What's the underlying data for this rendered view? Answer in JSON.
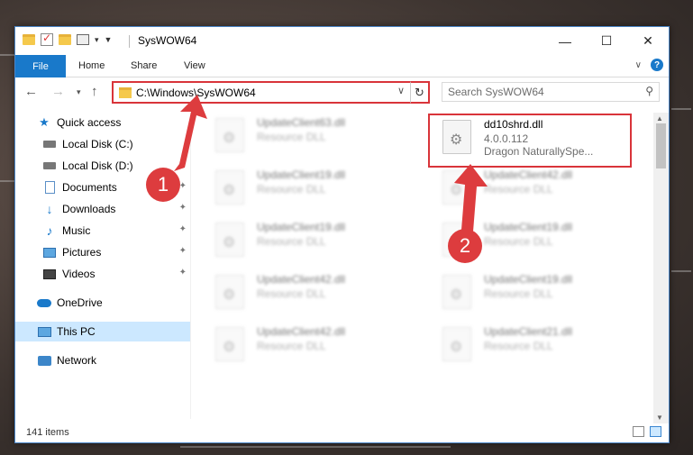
{
  "window": {
    "title": "SysWOW64",
    "controls": {
      "minimize": "—",
      "maximize": "☐",
      "close": "✕"
    }
  },
  "ribbon": {
    "tabs": [
      "File",
      "Home",
      "Share",
      "View"
    ],
    "help": "?"
  },
  "address_bar": {
    "path": "C:\\Windows\\SysWOW64",
    "search_placeholder": "Search SysWOW64"
  },
  "sidebar": {
    "items": [
      {
        "label": "Quick access",
        "icon": "star-icon",
        "pinned": false
      },
      {
        "label": "Local Disk (C:)",
        "icon": "drive-icon",
        "pinned": false
      },
      {
        "label": "Local Disk (D:)",
        "icon": "drive-icon",
        "pinned": true
      },
      {
        "label": "Documents",
        "icon": "document-icon",
        "pinned": true
      },
      {
        "label": "Downloads",
        "icon": "download-icon",
        "pinned": true
      },
      {
        "label": "Music",
        "icon": "music-icon",
        "pinned": true
      },
      {
        "label": "Pictures",
        "icon": "picture-icon",
        "pinned": true
      },
      {
        "label": "Videos",
        "icon": "video-icon",
        "pinned": true
      },
      {
        "label": "OneDrive",
        "icon": "cloud-icon",
        "pinned": false
      },
      {
        "label": "This PC",
        "icon": "pc-icon",
        "pinned": false,
        "selected": true
      },
      {
        "label": "Network",
        "icon": "network-icon",
        "pinned": false
      }
    ]
  },
  "files": {
    "highlighted": {
      "name": "dd10shrd.dll",
      "version": "4.0.0.112",
      "description": "Dragon NaturallySpe..."
    },
    "left_column": [
      {
        "name": "UpdateClient63.dll",
        "type": "Resource DLL"
      },
      {
        "name": "UpdateClient19.dll",
        "type": "Resource DLL"
      },
      {
        "name": "UpdateClient19.dll",
        "type": "Resource DLL"
      },
      {
        "name": "UpdateClient42.dll",
        "type": "Resource DLL"
      },
      {
        "name": "UpdateClient42.dll",
        "type": "Resource DLL"
      }
    ],
    "right_column": [
      {
        "name": "UpdateClient42.dll",
        "type": "Resource DLL"
      },
      {
        "name": "UpdateClient19.dll",
        "type": "Resource DLL"
      },
      {
        "name": "UpdateClient19.dll",
        "type": "Resource DLL"
      },
      {
        "name": "UpdateClient21.dll",
        "type": "Resource DLL"
      }
    ]
  },
  "status": {
    "item_count": "141 items"
  },
  "annotations": {
    "badge1": "1",
    "badge2": "2",
    "color": "#dd3c3e"
  }
}
